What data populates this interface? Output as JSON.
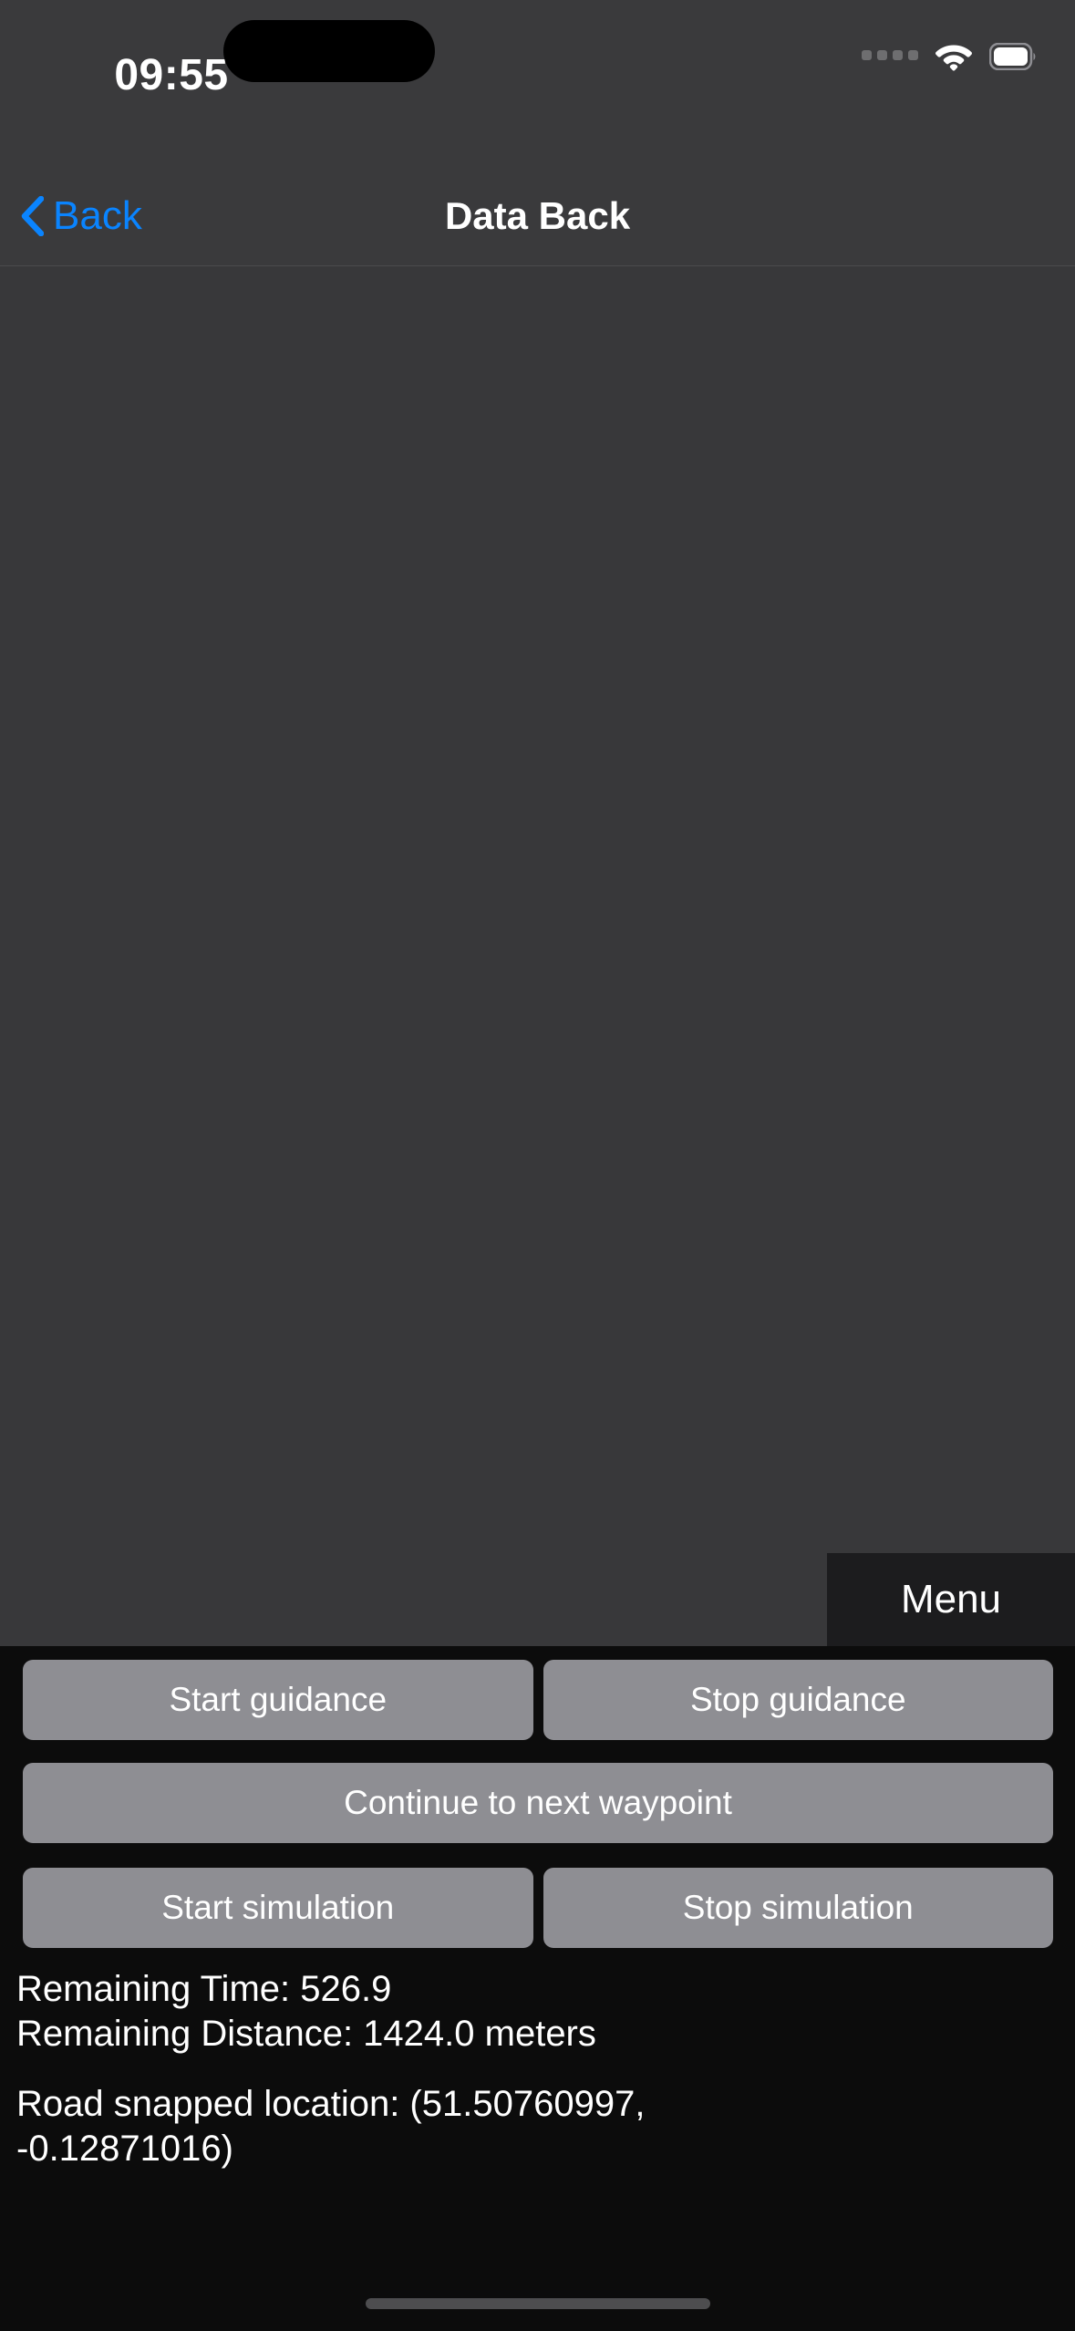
{
  "status_bar": {
    "time": "09:55",
    "cellular_icon": "signal-dots-icon",
    "wifi_icon": "wifi-icon",
    "battery_icon": "battery-full-icon"
  },
  "nav_bar": {
    "back_icon": "chevron-left-icon",
    "back_label": "Back",
    "title": "Data Back"
  },
  "map": {
    "overlay": {
      "menu_label": "Menu"
    }
  },
  "controls": {
    "rows": [
      {
        "buttons": [
          "Start guidance",
          "Stop guidance"
        ]
      },
      {
        "buttons": [
          "Continue to next waypoint"
        ]
      },
      {
        "buttons": [
          "Start simulation",
          "Stop simulation"
        ]
      }
    ],
    "start_guidance": "Start guidance",
    "stop_guidance": "Stop guidance",
    "continue_waypoint": "Continue to next waypoint",
    "start_simulation": "Start simulation",
    "stop_simulation": "Stop simulation"
  },
  "info": {
    "remaining_time": "Remaining Time: 526.9",
    "remaining_distance": "Remaining Distance: 1424.0 meters",
    "road_snapped_location": "Road snapped location: (51.50760997, -0.12871016)"
  },
  "colors": {
    "accent_blue": "#0a84ff",
    "button_gray": "#8e8e93",
    "bar_gray": "#3a3a3c",
    "map_gray": "#38383a",
    "panel_black": "#0c0c0c",
    "menu_black": "#1c1c1e"
  }
}
